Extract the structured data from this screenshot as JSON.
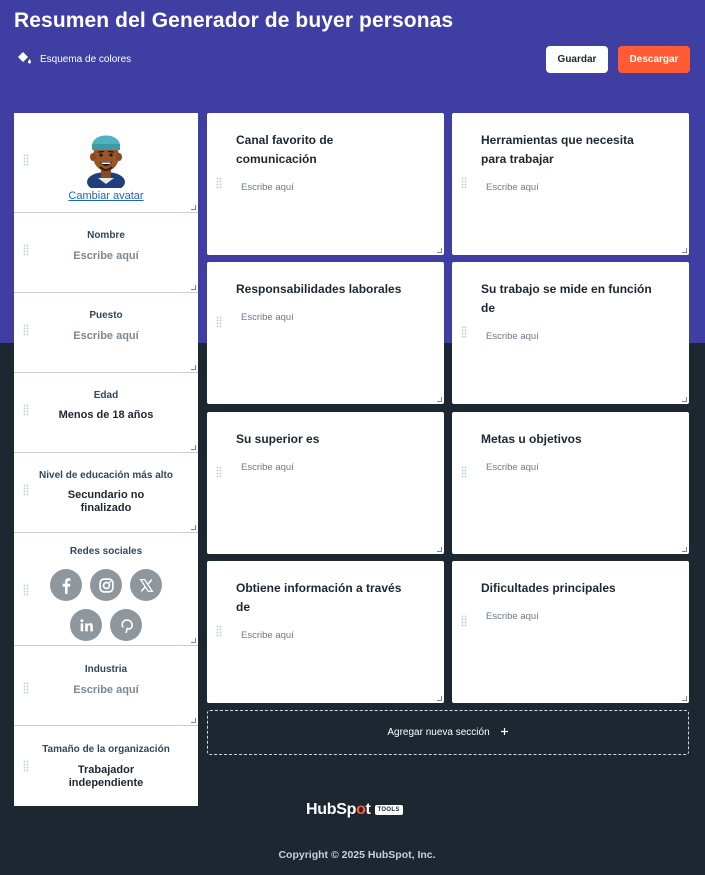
{
  "header": {
    "title": "Resumen del Generador de buyer personas",
    "color_scheme_label": "Esquema de colores",
    "save_label": "Guardar",
    "download_label": "Descargar"
  },
  "colors": {
    "header_bg": "#3f3ea2",
    "page_bg": "#1c2732",
    "accent": "#ff5c35"
  },
  "avatar": {
    "change_label": "Cambiar avatar"
  },
  "left_cards": {
    "name": {
      "label": "Nombre",
      "value": "Escribe aquí"
    },
    "job": {
      "label": "Puesto",
      "value": "Escribe aquí"
    },
    "age": {
      "label": "Edad",
      "value": "Menos de 18 años"
    },
    "education": {
      "label": "Nivel de educación más alto",
      "value": "Secundario no finalizado"
    },
    "social": {
      "label": "Redes sociales",
      "icons": [
        "facebook-icon",
        "instagram-icon",
        "x-icon",
        "linkedin-icon",
        "pinterest-icon"
      ]
    },
    "industry": {
      "label": "Industria",
      "value": "Escribe aquí"
    },
    "org_size": {
      "label": "Tamaño de la organización",
      "value": "Trabajador independiente"
    }
  },
  "sections": [
    {
      "title": "Canal favorito de comunicación",
      "placeholder": "Escribe aquí"
    },
    {
      "title": "Herramientas que necesita para trabajar",
      "placeholder": "Escribe aquí"
    },
    {
      "title": "Responsabilidades laborales",
      "placeholder": "Escribe aquí"
    },
    {
      "title": "Su trabajo se mide en función de",
      "placeholder": "Escribe aquí"
    },
    {
      "title": "Su superior es",
      "placeholder": "Escribe aquí"
    },
    {
      "title": "Metas u objetivos",
      "placeholder": "Escribe aquí"
    },
    {
      "title": "Obtiene información a través de",
      "placeholder": "Escribe aquí"
    },
    {
      "title": "Dificultades principales",
      "placeholder": "Escribe aquí"
    }
  ],
  "add_section": {
    "label": "Agregar nueva sección",
    "icon": "plus-icon"
  },
  "footer": {
    "logo_text_a": "HubSp",
    "logo_text_b": "t",
    "logo_tag": "TOOLS",
    "copyright": "Copyright © 2025 HubSpot, Inc."
  }
}
